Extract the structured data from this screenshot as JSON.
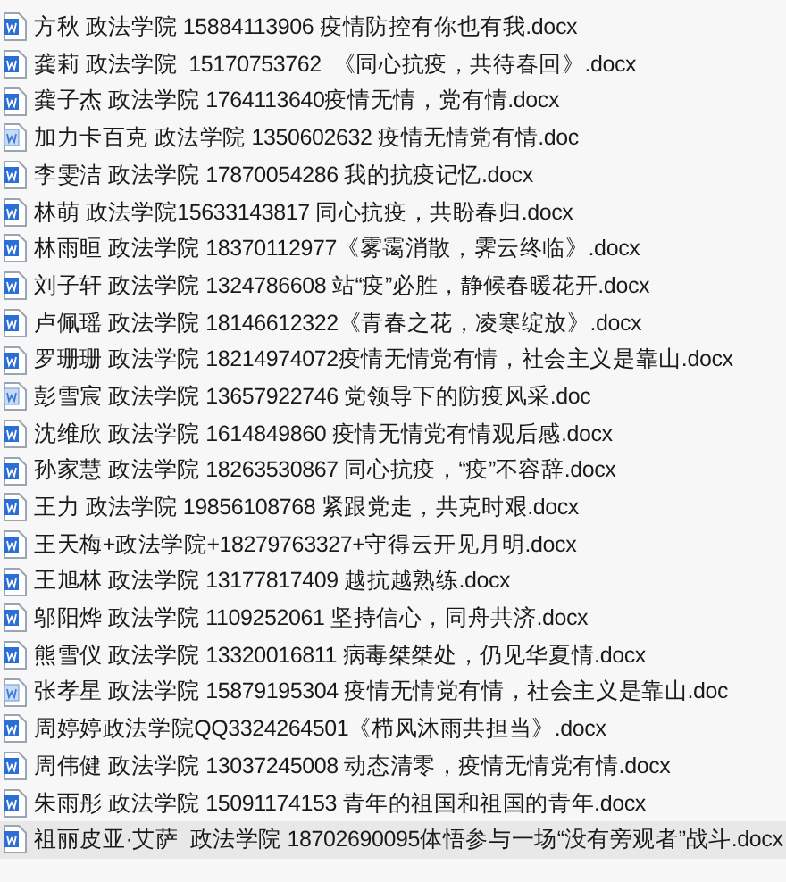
{
  "files": [
    {
      "name": "方秋 政法学院 15884113906 疫情防控有你也有我.docx",
      "kind": "docx",
      "hovered": false
    },
    {
      "name": "龚莉 政法学院  15170753762  《同心抗疫，共待春回》.docx",
      "kind": "docx",
      "hovered": false
    },
    {
      "name": "龚子杰 政法学院 1764113640疫情无情，党有情.docx",
      "kind": "docx",
      "hovered": false
    },
    {
      "name": "加力卡百克 政法学院 1350602632 疫情无情党有情.doc",
      "kind": "doc",
      "hovered": false
    },
    {
      "name": "李雯洁 政法学院 17870054286 我的抗疫记忆.docx",
      "kind": "docx",
      "hovered": false
    },
    {
      "name": "林萌 政法学院15633143817 同心抗疫，共盼春归.docx",
      "kind": "docx",
      "hovered": false
    },
    {
      "name": "林雨晅 政法学院 18370112977《雾霭消散，霁云终临》.docx",
      "kind": "docx",
      "hovered": false
    },
    {
      "name": "刘子轩 政法学院 1324786608 站“疫”必胜，静候春暖花开.docx",
      "kind": "docx",
      "hovered": false
    },
    {
      "name": "卢佩瑶 政法学院 18146612322《青春之花，凌寒绽放》.docx",
      "kind": "docx",
      "hovered": false
    },
    {
      "name": "罗珊珊 政法学院 18214974072疫情无情党有情，社会主义是靠山.docx",
      "kind": "docx",
      "hovered": false
    },
    {
      "name": "彭雪宸 政法学院 13657922746 党领导下的防疫风采.doc",
      "kind": "doc",
      "hovered": false
    },
    {
      "name": "沈维欣 政法学院 1614849860 疫情无情党有情观后感.docx",
      "kind": "docx",
      "hovered": false
    },
    {
      "name": "孙家慧 政法学院 18263530867 同心抗疫，“疫”不容辞.docx",
      "kind": "docx",
      "hovered": false
    },
    {
      "name": "王力 政法学院 19856108768 紧跟党走，共克时艰.docx",
      "kind": "docx",
      "hovered": false
    },
    {
      "name": "王天梅+政法学院+18279763327+守得云开见月明.docx",
      "kind": "docx",
      "hovered": false
    },
    {
      "name": "王旭林 政法学院 13177817409 越抗越熟练.docx",
      "kind": "docx",
      "hovered": false
    },
    {
      "name": "邬阳烨 政法学院 1109252061 坚持信心，同舟共济.docx",
      "kind": "docx",
      "hovered": false
    },
    {
      "name": "熊雪仪 政法学院 13320016811 病毒桀桀处，仍见华夏情.docx",
      "kind": "docx",
      "hovered": false
    },
    {
      "name": "张孝星 政法学院 15879195304 疫情无情党有情，社会主义是靠山.doc",
      "kind": "doc",
      "hovered": false
    },
    {
      "name": "周婷婷政法学院QQ3324264501《栉风沐雨共担当》.docx",
      "kind": "docx",
      "hovered": false
    },
    {
      "name": "周伟健 政法学院 13037245008 动态清零，疫情无情党有情.docx",
      "kind": "docx",
      "hovered": false
    },
    {
      "name": "朱雨彤 政法学院 15091174153 青年的祖国和祖国的青年.docx",
      "kind": "docx",
      "hovered": false
    },
    {
      "name": "祖丽皮亚·艾萨  政法学院 18702690095体悟参与一场“没有旁观者”战斗.docx",
      "kind": "docx",
      "hovered": true
    }
  ]
}
